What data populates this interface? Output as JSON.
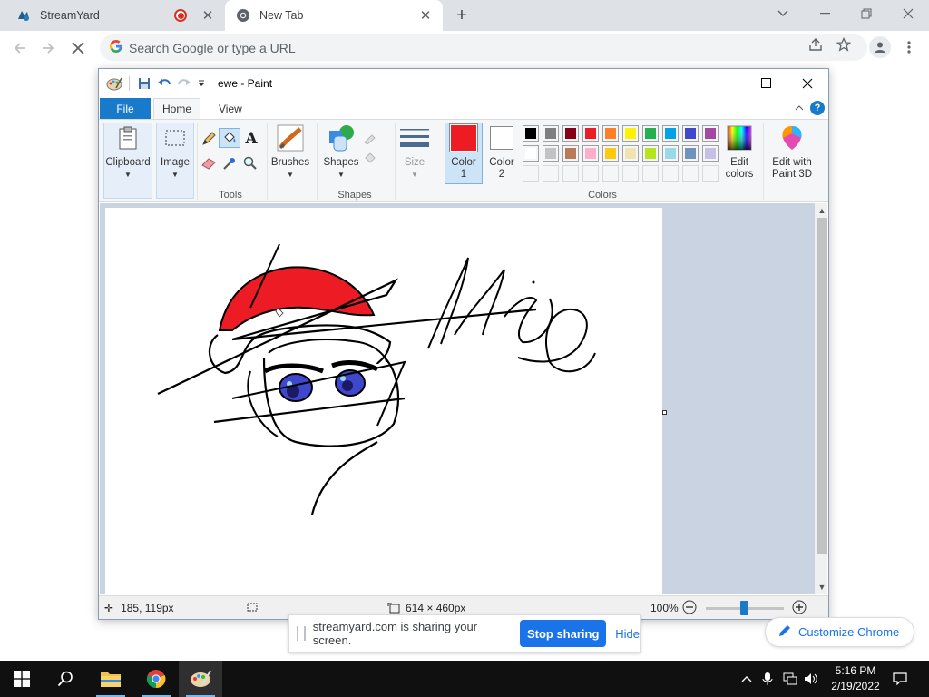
{
  "browser": {
    "tabs": [
      {
        "title": "StreamYard",
        "active": false,
        "recording": true
      },
      {
        "title": "New Tab",
        "active": true
      }
    ],
    "omnibox": {
      "placeholder": "Search Google or type a URL"
    }
  },
  "paint": {
    "window_title": "ewe - Paint",
    "ribbon_tabs": [
      "File",
      "Home",
      "View"
    ],
    "groups": {
      "clipboard": "Clipboard",
      "image": "Image",
      "tools": "Tools",
      "brushes": "Brushes",
      "shapes_btn": "Shapes",
      "shapes_group": "Shapes",
      "size": "Size",
      "color1_line1": "Color",
      "color1_line2": "1",
      "color2_line1": "Color",
      "color2_line2": "2",
      "colors": "Colors",
      "edit_colors_line1": "Edit",
      "edit_colors_line2": "colors",
      "paint3d_line1": "Edit with",
      "paint3d_line2": "Paint 3D"
    },
    "color1": "#ed1c24",
    "color2": "#ffffff",
    "palette_row1": [
      "#000000",
      "#7f7f7f",
      "#880015",
      "#ed1c24",
      "#ff7f27",
      "#fff200",
      "#22b14c",
      "#00a2e8",
      "#3f48cc",
      "#a349a4"
    ],
    "palette_row2": [
      "#ffffff",
      "#c3c3c3",
      "#b97a57",
      "#ffaec9",
      "#ffc90e",
      "#efe4b0",
      "#b5e61d",
      "#99d9ea",
      "#7092be",
      "#c8bfe7"
    ],
    "palette_row3": [
      "#f5f6f7",
      "#f5f6f7",
      "#f5f6f7",
      "#f5f6f7",
      "#f5f6f7",
      "#f5f6f7",
      "#f5f6f7",
      "#f5f6f7",
      "#f5f6f7",
      "#f5f6f7"
    ],
    "status": {
      "cursor_pos": "185, 119px",
      "canvas_size": "614 × 460px",
      "zoom": "100%"
    }
  },
  "sharebar": {
    "message": "streamyard.com is sharing your screen.",
    "stop_label": "Stop sharing",
    "hide_label": "Hide"
  },
  "customize_chrome": "Customize Chrome",
  "taskbar": {
    "time": "5:16 PM",
    "date": "2/19/2022"
  }
}
